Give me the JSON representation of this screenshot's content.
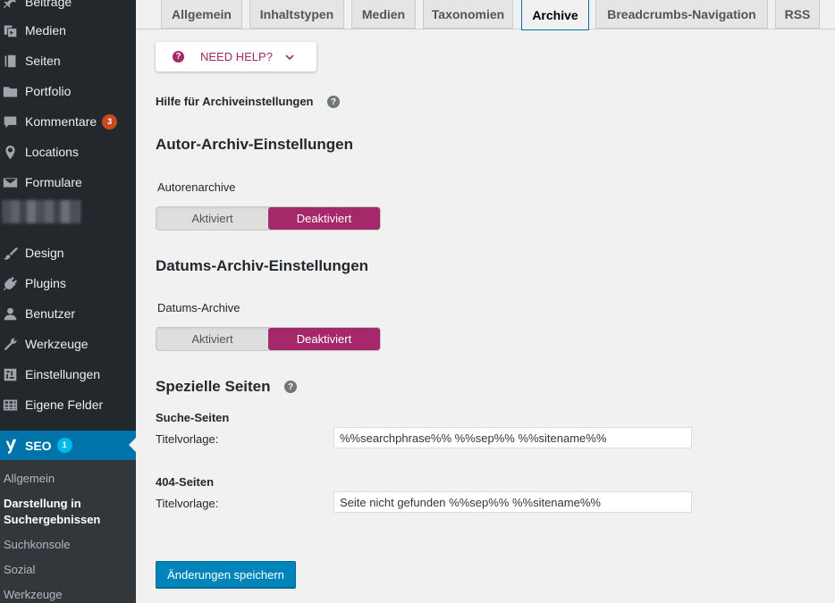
{
  "sidebar": {
    "items": [
      {
        "label": "Beiträge",
        "icon": "pin-icon"
      },
      {
        "label": "Medien",
        "icon": "media-icon"
      },
      {
        "label": "Seiten",
        "icon": "pages-icon"
      },
      {
        "label": "Portfolio",
        "icon": "folder-icon"
      },
      {
        "label": "Kommentare",
        "icon": "comment-icon",
        "badge": "3"
      },
      {
        "label": "Locations",
        "icon": "location-icon"
      },
      {
        "label": "Formulare",
        "icon": "mail-icon"
      },
      {
        "label": "Design",
        "icon": "brush-icon"
      },
      {
        "label": "Plugins",
        "icon": "plugin-icon"
      },
      {
        "label": "Benutzer",
        "icon": "user-icon"
      },
      {
        "label": "Werkzeuge",
        "icon": "wrench-icon"
      },
      {
        "label": "Einstellungen",
        "icon": "settings-icon"
      },
      {
        "label": "Eigene Felder",
        "icon": "table-icon"
      }
    ],
    "seo": {
      "label": "SEO",
      "badge": "1"
    },
    "submenu": [
      {
        "label": "Allgemein"
      },
      {
        "label": "Darstellung in",
        "label2": "Suchergebnissen"
      },
      {
        "label": "Suchkonsole"
      },
      {
        "label": "Sozial"
      },
      {
        "label": "Werkzeuge"
      }
    ]
  },
  "tabs": [
    {
      "label": "Allgemein"
    },
    {
      "label": "Inhaltstypen"
    },
    {
      "label": "Medien"
    },
    {
      "label": "Taxonomien"
    },
    {
      "label": "Archive",
      "active": true
    },
    {
      "label": "Breadcrumbs-Navigation"
    },
    {
      "label": "RSS"
    }
  ],
  "help_button": {
    "label": "NEED HELP?"
  },
  "help_link": {
    "label": "Hilfe für Archiveinstellungen"
  },
  "author_section": {
    "title": "Autor-Archiv-Einstellungen",
    "field_label": "Autorenarchive",
    "options": [
      "Aktiviert",
      "Deaktiviert"
    ],
    "selected": "Deaktiviert"
  },
  "date_section": {
    "title": "Datums-Archiv-Einstellungen",
    "field_label": "Datums-Archive",
    "options": [
      "Aktiviert",
      "Deaktiviert"
    ],
    "selected": "Deaktiviert"
  },
  "special_pages": {
    "title": "Spezielle Seiten",
    "search": {
      "heading": "Suche-Seiten",
      "label": "Titelvorlage:",
      "value": "%%searchphrase%% %%sep%% %%sitename%%"
    },
    "not_found": {
      "heading": "404-Seiten",
      "label": "Titelvorlage:",
      "value": "Seite nicht gefunden %%sep%% %%sitename%%"
    }
  },
  "save_button": {
    "label": "Änderungen speichern"
  },
  "colors": {
    "accent": "#a4286a",
    "admin_blue": "#0073aa",
    "sidebar_bg": "#23282d"
  }
}
